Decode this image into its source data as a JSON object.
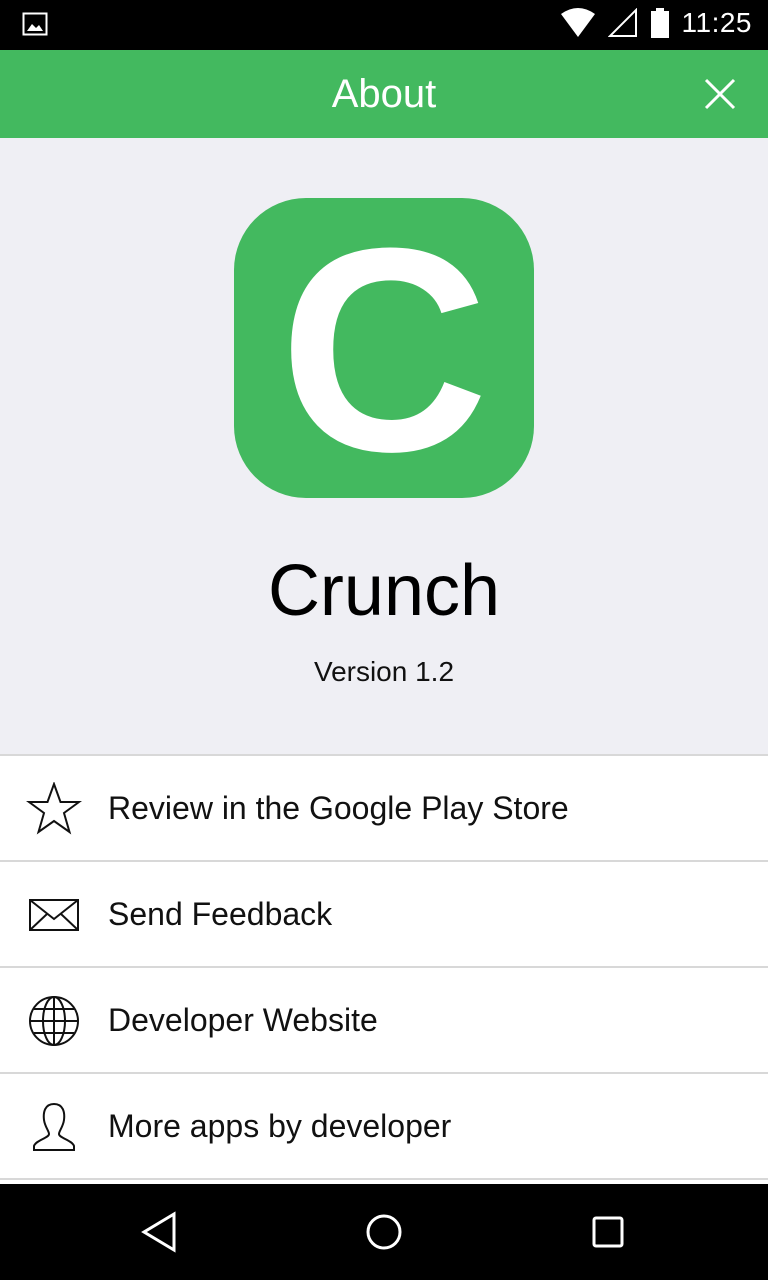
{
  "status_bar": {
    "time": "11:25",
    "icons": [
      "image-notification-icon",
      "wifi-icon",
      "signal-icon",
      "battery-icon"
    ]
  },
  "app_bar": {
    "title": "About",
    "close_icon": "close-icon"
  },
  "hero": {
    "app_icon_letter": "C",
    "app_name": "Crunch",
    "version": "Version 1.2"
  },
  "menu": {
    "items": [
      {
        "label": "Review in the Google Play Store",
        "icon": "star-icon"
      },
      {
        "label": "Send Feedback",
        "icon": "mail-icon"
      },
      {
        "label": "Developer Website",
        "icon": "globe-icon"
      },
      {
        "label": "More apps by developer",
        "icon": "person-icon"
      }
    ]
  },
  "nav_bar": {
    "icons": [
      "back-icon",
      "home-icon",
      "recents-icon"
    ]
  },
  "colors": {
    "accent": "#43b95f",
    "background": "#efeff4",
    "status_bar": "#000000"
  }
}
